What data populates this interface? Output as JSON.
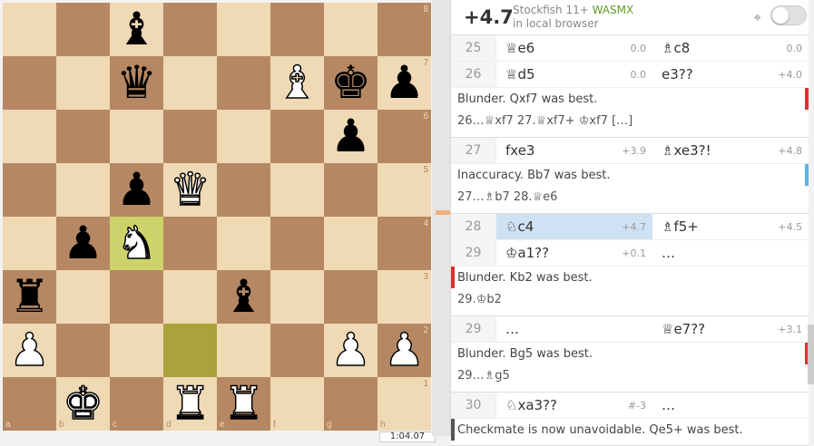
{
  "board": {
    "ranks": [
      "8",
      "7",
      "6",
      "5",
      "4",
      "3",
      "2",
      "1"
    ],
    "files": [
      "a",
      "b",
      "c",
      "d",
      "e",
      "f",
      "g",
      "h"
    ],
    "rows": [
      [
        "",
        "",
        "bB",
        "",
        "",
        "",
        "",
        ""
      ],
      [
        "",
        "",
        "bQ",
        "",
        "",
        "wB",
        "bK",
        "bP"
      ],
      [
        "",
        "",
        "",
        "",
        "",
        "",
        "bP",
        ""
      ],
      [
        "",
        "",
        "bP",
        "wQ",
        "",
        "",
        "",
        ""
      ],
      [
        "",
        "bP",
        "wN",
        "",
        "",
        "",
        "",
        ""
      ],
      [
        "bR",
        "",
        "",
        "",
        "bB",
        "",
        "",
        ""
      ],
      [
        "wP",
        "",
        "",
        "",
        "",
        "",
        "wP",
        "wP"
      ],
      [
        "",
        "wK",
        "",
        "wR",
        "wR",
        "",
        "",
        ""
      ]
    ],
    "highlight_to": "c4",
    "highlight_from": "d2",
    "glyphs": {
      "K": "♚",
      "Q": "♛",
      "R": "♜",
      "B": "♝",
      "N": "♞",
      "P": "♟"
    }
  },
  "clock": "1:04.07",
  "engine": {
    "eval": "+4.7",
    "name": "Stockfish 11+",
    "variant": "WASMX",
    "location": "in local browser",
    "target_icon": "target-icon",
    "toggle_on": false
  },
  "moves": [
    {
      "type": "row",
      "num": "25",
      "white": "♕e6",
      "white_eval": "0.0",
      "black": "♗c8",
      "black_eval": "0.0"
    },
    {
      "type": "row",
      "num": "26",
      "white": "♕d5",
      "white_eval": "0.0",
      "black": "e3??",
      "black_eval": "+4.0"
    },
    {
      "type": "comment",
      "text": "Blunder. Qxf7 was best.",
      "variation": "26…♕xf7 27.♕xf7+ ♔xf7 […]",
      "bar": "red",
      "side": "r"
    },
    {
      "type": "row",
      "num": "27",
      "white": "fxe3",
      "white_eval": "+3.9",
      "black": "♗xe3?!",
      "black_eval": "+4.8"
    },
    {
      "type": "comment",
      "text": "Inaccuracy. Bb7 was best.",
      "variation": "27…♗b7 28.♕e6",
      "bar": "blue",
      "side": "r"
    },
    {
      "type": "row",
      "num": "28",
      "white": "♘c4",
      "white_eval": "+4.7",
      "black": "♗f5+",
      "black_eval": "+4.5",
      "active": "white"
    },
    {
      "type": "row",
      "num": "29",
      "white": "♔a1??",
      "white_eval": "+0.1",
      "black": "…",
      "black_eval": ""
    },
    {
      "type": "comment",
      "text": "Blunder. Kb2 was best.",
      "variation": "29.♔b2",
      "bar": "red",
      "side": "l"
    },
    {
      "type": "row",
      "num": "29",
      "white": "…",
      "white_eval": "",
      "black": "♕e7??",
      "black_eval": "+3.1"
    },
    {
      "type": "comment",
      "text": "Blunder. Bg5 was best.",
      "variation": "29…♗g5",
      "bar": "red",
      "side": "r"
    },
    {
      "type": "row",
      "num": "30",
      "white": "♘xa3??",
      "white_eval": "#-3",
      "black": "…",
      "black_eval": ""
    },
    {
      "type": "comment",
      "text": "Checkmate is now unavoidable. Qe5+ was best.",
      "variation": "",
      "bar": "dark",
      "side": "l",
      "last": true
    }
  ],
  "colors": {
    "red": "#dc322f",
    "blue": "#56b4e9",
    "dark": "#555555"
  }
}
